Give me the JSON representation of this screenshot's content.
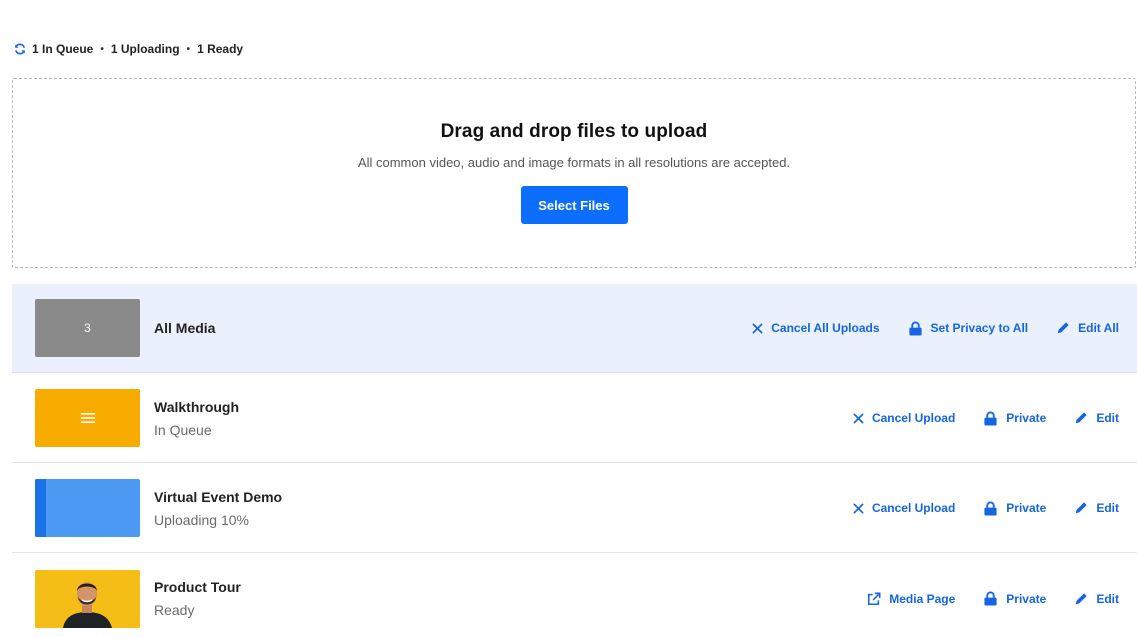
{
  "status": {
    "in_queue": "1 In Queue",
    "uploading": "1 Uploading",
    "ready": "1 Ready",
    "separator": "•"
  },
  "dropzone": {
    "title": "Drag and drop files to upload",
    "description": "All common video, audio and image formats in all resolutions are accepted.",
    "button_label": "Select Files"
  },
  "all_media": {
    "count": "3",
    "title": "All Media",
    "actions": {
      "cancel": "Cancel All Uploads",
      "privacy": "Set Privacy to All",
      "edit": "Edit All"
    }
  },
  "items": [
    {
      "title": "Walkthrough",
      "status": "In Queue",
      "actions": {
        "primary": "Cancel Upload",
        "privacy": "Private",
        "edit": "Edit"
      }
    },
    {
      "title": "Virtual Event Demo",
      "status": "Uploading 10%",
      "progress_percent": 10,
      "actions": {
        "primary": "Cancel Upload",
        "privacy": "Private",
        "edit": "Edit"
      }
    },
    {
      "title": "Product Tour",
      "status": "Ready",
      "actions": {
        "primary": "Media Page",
        "privacy": "Private",
        "edit": "Edit"
      }
    }
  ],
  "colors": {
    "accent": "#0d6efd",
    "link": "#1565e0",
    "header_bg": "#eaf1fc",
    "queue_thumb": "#f8ac00",
    "upload_thumb": "#4d9af5",
    "count_thumb": "#8a8a8a"
  }
}
